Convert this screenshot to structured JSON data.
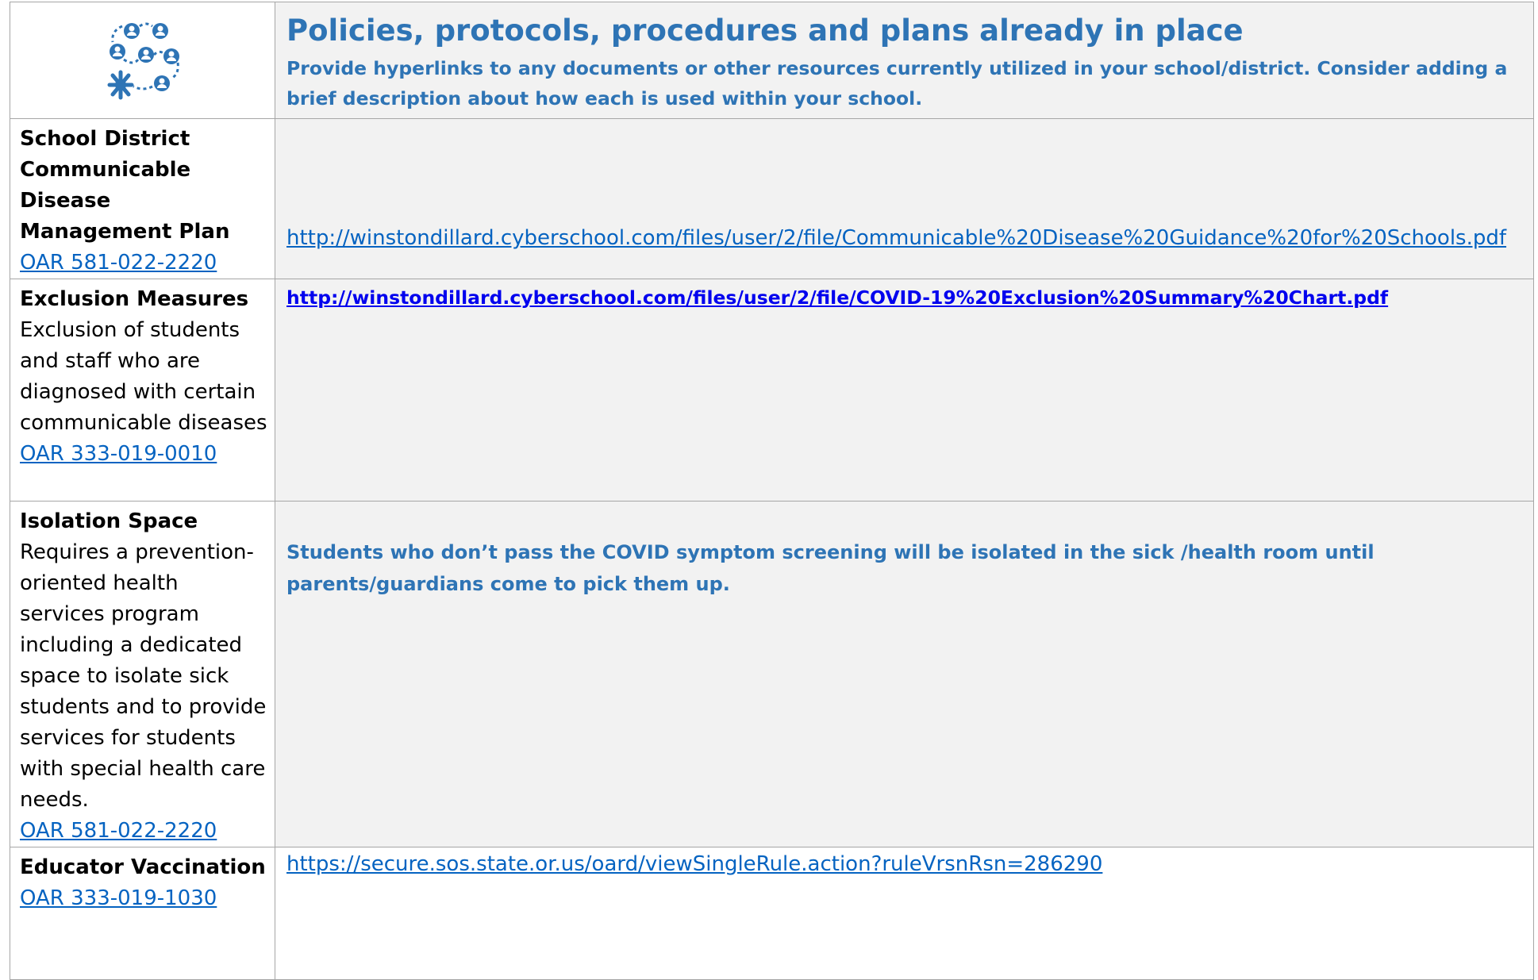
{
  "header": {
    "title": "Policies, protocols, procedures and plans already in place",
    "subtitle": "Provide hyperlinks to any documents or other resources currently utilized in your school/district. Consider adding a brief description about how each is used within your school.",
    "icon": "network-people-icon",
    "icon_color": "#2e74b5"
  },
  "rows": [
    {
      "title": "School District Communicable Disease Management Plan",
      "description": "",
      "rule": "OAR 581-022-2220",
      "content": "http://winstondillard.cyberschool.com/files/user/2/file/Communicable%20Disease%20Guidance%20for%20Schools.pdf"
    },
    {
      "title": "Exclusion Measures",
      "description": "Exclusion of students and staff who are diagnosed with certain communicable diseases",
      "rule": "OAR 333-019-0010",
      "content": "http://winstondillard.cyberschool.com/files/user/2/file/COVID-19%20Exclusion%20Summary%20Chart.pdf"
    },
    {
      "title": "Isolation Space",
      "description": "Requires a prevention-oriented health services program including a dedicated space to isolate sick students and to provide services for students with special health care needs.",
      "rule": "OAR 581-022-2220",
      "content": "Students who don’t pass the COVID symptom screening will be isolated in the sick /health room until parents/guardians come to pick them up."
    },
    {
      "title": "Educator Vaccination",
      "description": "",
      "rule": "OAR 333-019-1030",
      "content": "https://secure.sos.state.or.us/oard/viewSingleRule.action?ruleVrsnRsn=286290"
    }
  ]
}
